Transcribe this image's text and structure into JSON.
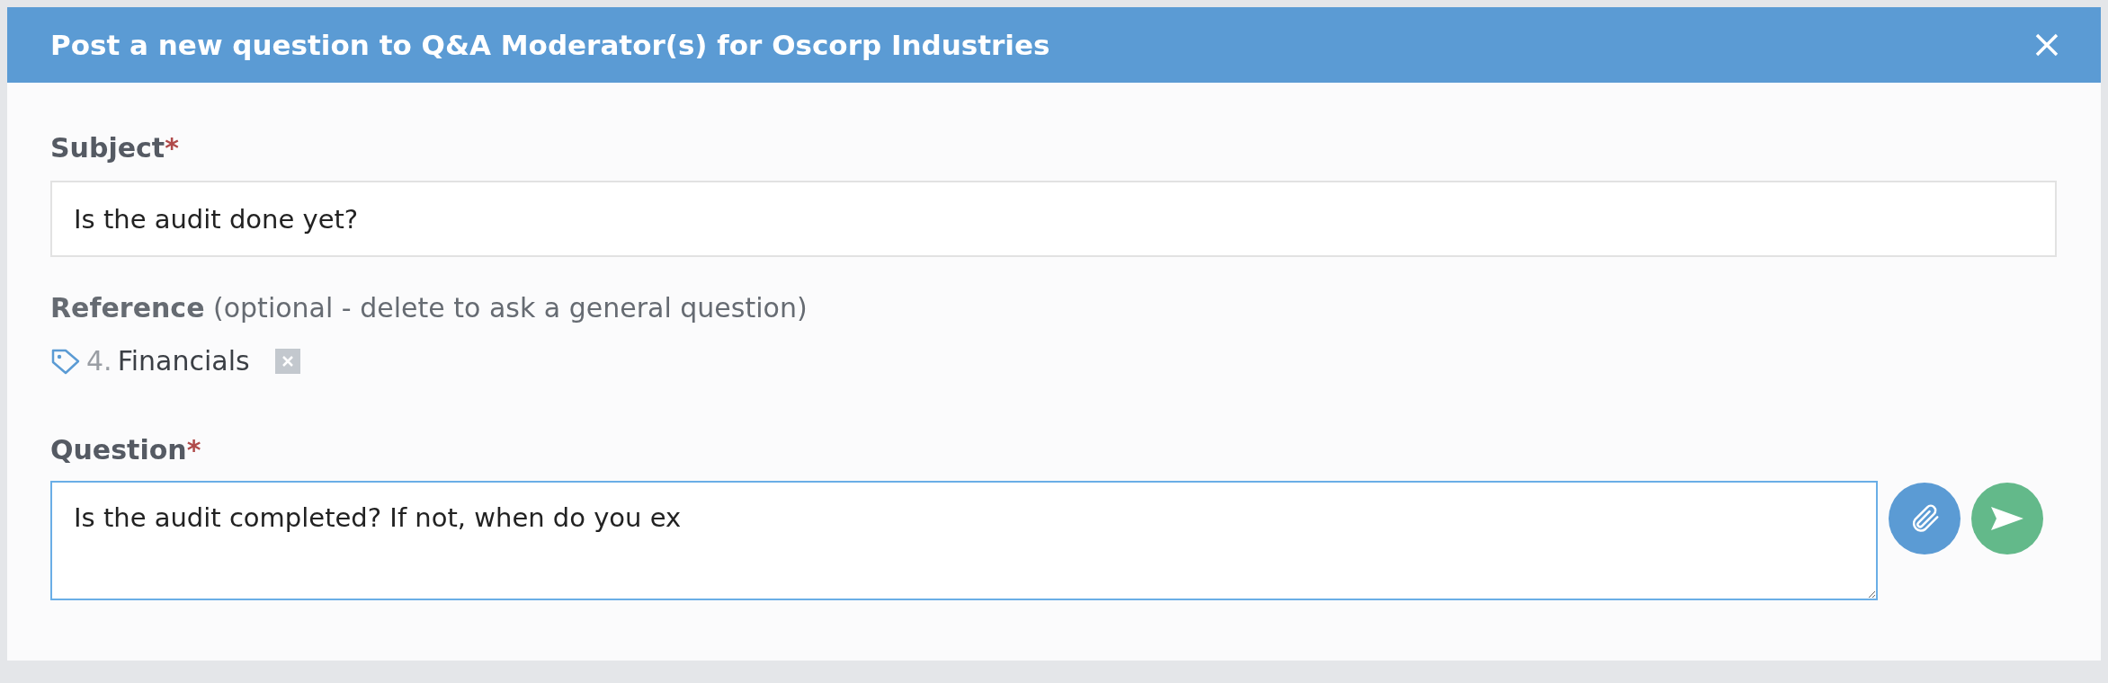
{
  "dialog": {
    "title": "Post a new question to Q&A Moderator(s) for Oscorp Industries"
  },
  "subject": {
    "label": "Subject",
    "required_mark": "*",
    "value": "Is the audit done yet?"
  },
  "reference": {
    "label": "**Reference** (optional - delete to ask a general question)",
    "tag": {
      "number": "4.",
      "name": "Financials"
    }
  },
  "question": {
    "label": "Question",
    "required_mark": "*",
    "value": "Is the audit completed? If not, when do you ex",
    "focused": true
  }
}
